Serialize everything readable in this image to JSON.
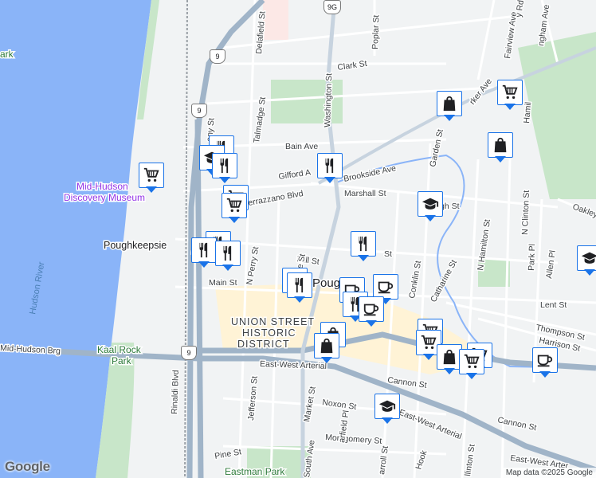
{
  "map": {
    "attribution": "Map data ©2025 Google",
    "logo": "Google",
    "city_label": "Pough",
    "district_label": [
      "UNION STREET",
      "HISTORIC",
      "DISTRICT"
    ],
    "poi": {
      "museum": [
        "Mid-Hudson",
        "Discovery Museum"
      ],
      "station": "Poughkeepsie",
      "park_partial": "ark",
      "kaal_rock": [
        "Kaal Rock",
        "Park"
      ],
      "eastman": "Eastman Park"
    },
    "water": {
      "hudson_river": "Hudson River"
    },
    "shields": {
      "us9_a": "9",
      "us9_b": "9",
      "us9_c": "9",
      "ny9g": "9G"
    },
    "streets": {
      "washington": "Washington St",
      "poplar": "Poplar St",
      "clark": "Clark St",
      "delafield": "Delafield St",
      "talmadge": "Talmadge St",
      "bain": "Bain Ave",
      "gifford": "Gifford A",
      "brookside": "Brookside Ave",
      "verrazzano": "errazzano Blvd",
      "marshall": "Marshall St",
      "garden": "Garden St",
      "oakley": "Oakley",
      "mill": "Mill St",
      "north_perry": "N Perry St",
      "n_bridge": "N Bridge St",
      "main": "Main St",
      "n_hamilton": "N Hamilton St",
      "n_clinton": "N Clinton St",
      "park_pl": "Park Pl",
      "allen": "Allen Pl",
      "catharine": "Catharine St",
      "conklin": "Conklin St",
      "lent": "Lent St",
      "thompson": "Thompson St",
      "harrison": "Harrison St",
      "mid_hudson_brg": "Mid-Hudson Brg",
      "east_west_a": "East-West Arterial",
      "east_west_b": "East-West Arterial",
      "east_west_c": "East-West Arterial",
      "east_west_d": "East-West Arter",
      "cannon_a": "Cannon St",
      "cannon_b": "Cannon St",
      "noxon": "Noxon St",
      "montgomery": "Montgomery St",
      "pine": "Pine St",
      "jefferson": "Jefferson St",
      "rinaldi": "Rinaldi Blvd",
      "market": "Market St",
      "south_ave": "South Ave",
      "garfield": "arfield Pl",
      "fairview": "Fairview Ave",
      "parker": "rker Ave",
      "hamilton_n": "Hamil",
      "hook": "Hook",
      "ighland": "gh St",
      "n_s_a": "St",
      "ony": "any St",
      "dut": "Da",
      "cook": "ngham Ave",
      "ridge_rd": "y Rd",
      "carroll": "arroll St",
      "ll": "llinton St",
      "m_st": "Mill St",
      "hamilton_side": "Ham"
    },
    "icons": [
      {
        "type": "restaurant-icon"
      },
      {
        "type": "shopping-bag-icon"
      },
      {
        "type": "shopping-cart-icon"
      },
      {
        "type": "school-icon"
      },
      {
        "type": "coffee-icon"
      }
    ]
  }
}
